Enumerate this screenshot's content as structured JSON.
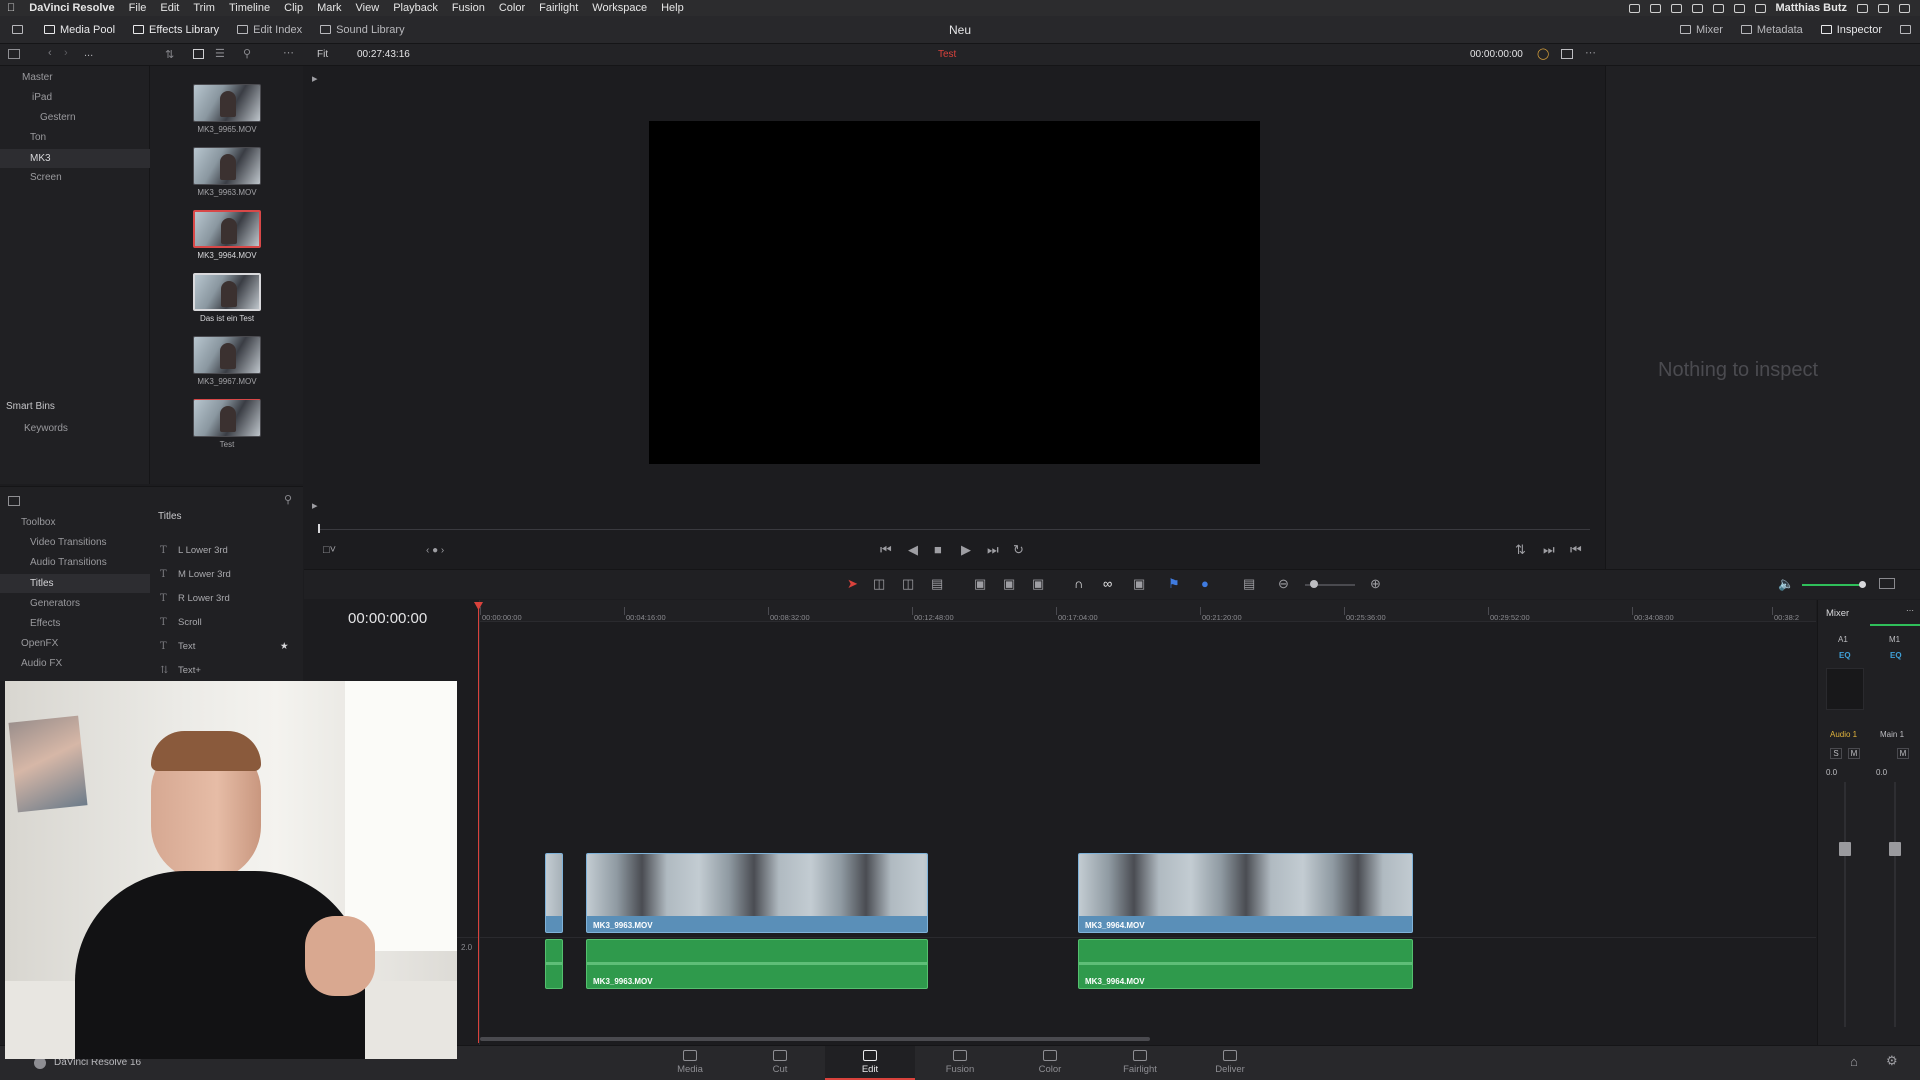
{
  "menubar": {
    "app_name": "DaVinci Resolve",
    "items": [
      "File",
      "Edit",
      "Trim",
      "Timeline",
      "Clip",
      "Mark",
      "View",
      "Playback",
      "Fusion",
      "Color",
      "Fairlight",
      "Workspace",
      "Help"
    ],
    "user": "Matthias Butz"
  },
  "topbar": {
    "title": "Neu",
    "left_buttons": [
      "Media Pool",
      "Effects Library",
      "Edit Index",
      "Sound Library"
    ],
    "right_buttons": [
      "Mixer",
      "Metadata",
      "Inspector"
    ]
  },
  "viewer_bar": {
    "fit": "Fit",
    "source_timecode": "00:27:43:16",
    "timeline_name": "Test",
    "timecode": "00:00:00:00"
  },
  "bins": {
    "items": [
      {
        "label": "Master"
      },
      {
        "label": "iPad"
      },
      {
        "label": "Gestern"
      },
      {
        "label": "Ton"
      },
      {
        "label": "MK3"
      },
      {
        "label": "Screen"
      }
    ],
    "smart_bins_label": "Smart Bins",
    "keywords_label": "Keywords"
  },
  "clips": [
    {
      "label": "MK3_9965.MOV"
    },
    {
      "label": "MK3_9963.MOV"
    },
    {
      "label": "MK3_9964.MOV"
    },
    {
      "label": "Das ist ein Test"
    },
    {
      "label": "MK3_9967.MOV"
    },
    {
      "label": "Test"
    }
  ],
  "toolbox": {
    "items": [
      "Toolbox",
      "Video Transitions",
      "Audio Transitions",
      "Titles",
      "Generators",
      "Effects",
      "OpenFX",
      "Audio FX"
    ],
    "selected": "Titles"
  },
  "titles_panel": {
    "heading": "Titles",
    "items": [
      "L Lower 3rd",
      "M Lower 3rd",
      "R Lower 3rd",
      "Scroll",
      "Text",
      "Text+"
    ]
  },
  "inspector": {
    "empty_text": "Nothing to inspect"
  },
  "timeline": {
    "timecode": "00:00:00:00",
    "ruler": [
      "00:00:00:00",
      "00:04:16:00",
      "00:08:32:00",
      "00:12:48:00",
      "00:17:04:00",
      "00:21:20:00",
      "00:25:36:00",
      "00:29:52:00",
      "00:34:08:00",
      "00:38:2"
    ],
    "track_label": "2.0",
    "video_clips": [
      {
        "name": "MK3_9963.MOV"
      },
      {
        "name": "MK3_9964.MOV"
      }
    ],
    "audio_clips": [
      {
        "name": "MK3_9963.MOV"
      },
      {
        "name": "MK3_9964.MOV"
      }
    ]
  },
  "mixer": {
    "title": "Mixer",
    "ch1": "A1",
    "ch2": "M1",
    "eq": "EQ",
    "bus1": "Audio 1",
    "bus2": "Main 1",
    "s": "S",
    "m": "M",
    "val1": "0.0",
    "val2": "0.0"
  },
  "pages": [
    "Media",
    "Cut",
    "Edit",
    "Fusion",
    "Color",
    "Fairlight",
    "Deliver"
  ],
  "active_page": "Edit",
  "footer": {
    "app_version": "DaVinci Resolve 16"
  },
  "colors": {
    "accent": "#d9423c",
    "video_clip": "#5a8fb8",
    "audio_clip": "#2f9a4c"
  }
}
